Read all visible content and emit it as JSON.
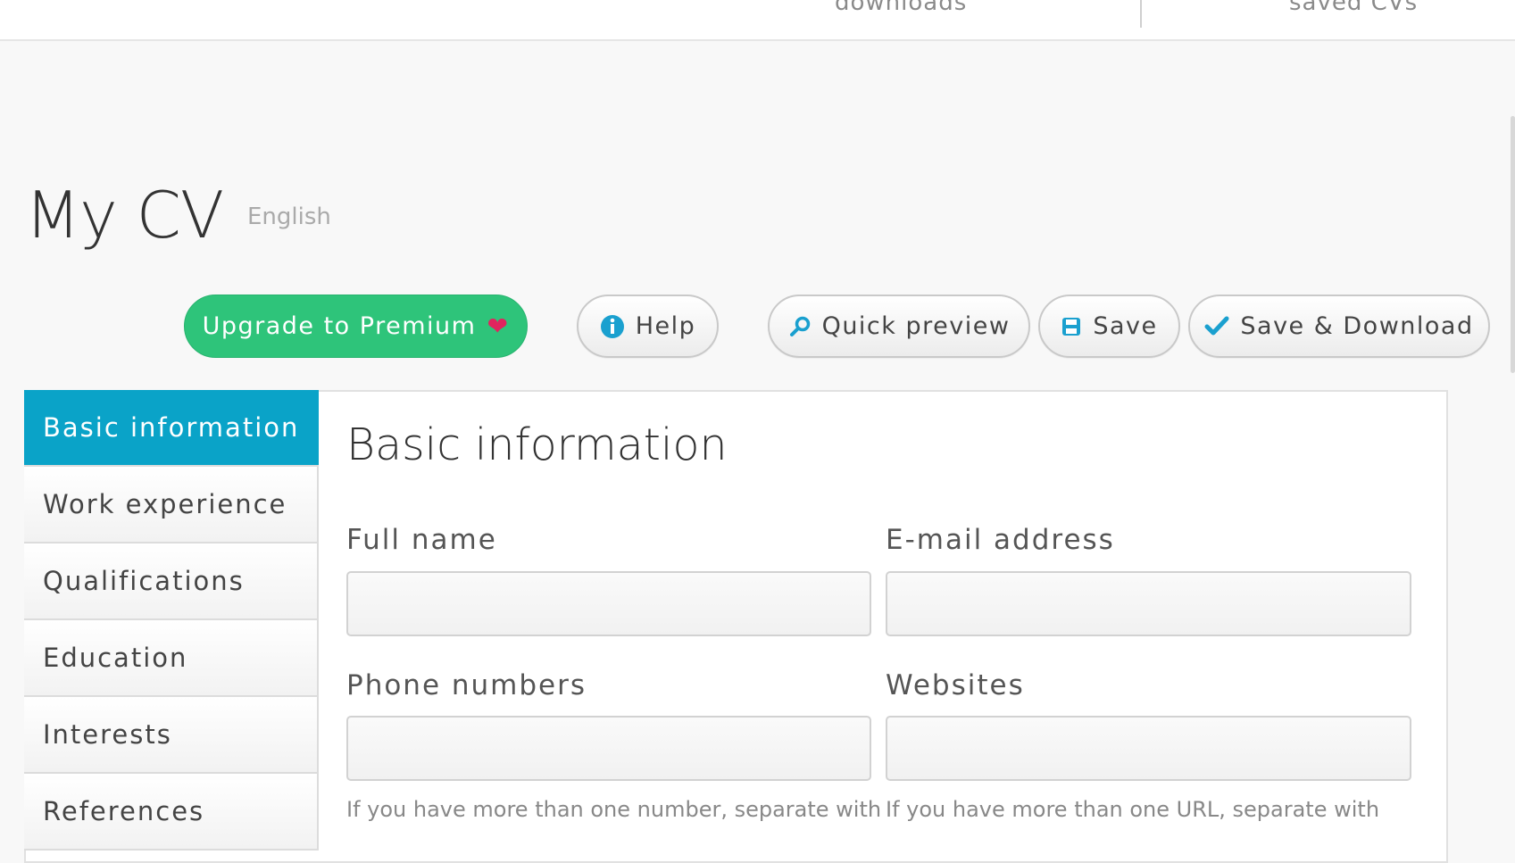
{
  "topnav": {
    "downloads_label": "downloads",
    "saved_label": "saved CVs"
  },
  "page": {
    "title": "My CV",
    "language": "English"
  },
  "toolbar": {
    "premium_label": "Upgrade to Premium",
    "premium_icon": "heart-icon",
    "help_label": "Help",
    "help_icon": "info-icon",
    "preview_label": "Quick preview",
    "preview_icon": "magnifier-icon",
    "save_label": "Save",
    "save_icon": "floppy-icon",
    "save_download_label": "Save & Download",
    "save_download_icon": "check-icon"
  },
  "sidebar": {
    "items": [
      {
        "label": "Basic information",
        "active": true
      },
      {
        "label": "Work experience",
        "active": false
      },
      {
        "label": "Qualifications",
        "active": false
      },
      {
        "label": "Education",
        "active": false
      },
      {
        "label": "Interests",
        "active": false
      },
      {
        "label": "References",
        "active": false
      }
    ]
  },
  "form": {
    "section_title": "Basic information",
    "full_name_label": "Full name",
    "full_name_value": "",
    "email_label": "E-mail address",
    "email_value": "",
    "phone_label": "Phone numbers",
    "phone_value": "",
    "phone_hint": "If you have more than one number, separate with",
    "websites_label": "Websites",
    "websites_value": "",
    "websites_hint": "If you have more than one URL, separate with"
  },
  "colors": {
    "premium_green": "#2ec47a",
    "active_blue": "#0aa3c8",
    "icon_blue": "#1aa0cf",
    "heart_red": "#e0245e"
  }
}
